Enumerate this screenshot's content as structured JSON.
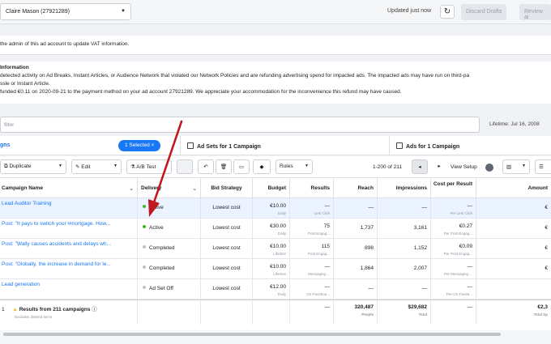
{
  "topbar": {
    "account": "Claire Mason (27921289)",
    "updated": "Updated just now",
    "discard": "Discard Drafts",
    "review": "Review ai"
  },
  "banner1": {
    "text": "the admin of this ad account to update VAT information."
  },
  "banner2": {
    "title": "Information",
    "line1": "detected activity on Ad Breaks, Instant Articles, or Audience Network that violated our Network Policies and are refunding advertising spend for impacted ads. The impacted ads may have run on third-pa",
    "line2": "ssle or Instant Article.",
    "line3": "funded €0.11 on 2020-09-21 to the payment method on your ad account 27921289. We appreciate your accommodation for the inconvenience this refund may have caused."
  },
  "filter": {
    "placeholder": "filter",
    "lifetime": "Lifetime: Jul 16, 2008"
  },
  "tabs": {
    "campaigns": "gns",
    "selected": "1 Selected",
    "adsets": "Ad Sets for 1 Campaign",
    "ads": "Ads for 1 Campaign"
  },
  "toolbar": {
    "duplicate": "Duplicate",
    "edit": "Edit",
    "abtest": "A/B Test",
    "rules": "Rules",
    "range": "1-200 of 211",
    "view_setup": "View Setup"
  },
  "headers": {
    "name": "Campaign Name",
    "delivery": "Delivery",
    "bid": "Bid Strategy",
    "budget": "Budget",
    "results": "Results",
    "reach": "Reach",
    "impressions": "Impressions",
    "cpr": "Cost per Result",
    "amount": "Amount"
  },
  "rows": [
    {
      "name": "Lead Auditor Training",
      "delivery": "Active",
      "status_color": "#42b72a",
      "bid": "Lowest cost",
      "budget": "€10.00",
      "budget_sub": "Daily",
      "results": "—",
      "results_sub": "Link Click",
      "reach": "—",
      "impressions": "—",
      "cpr": "—",
      "cpr_sub": "Per Link Click",
      "amount": "€"
    },
    {
      "name": "Post: \"It pays to switch your #mortgage. How...",
      "delivery": "Active",
      "status_color": "#42b72a",
      "bid": "Lowest cost",
      "budget": "€30.00",
      "budget_sub": "Daily",
      "results": "75",
      "results_sub": "Post Engag...",
      "reach": "1,737",
      "impressions": "3,161",
      "cpr": "€0.27",
      "cpr_sub": "Per Post Engag...",
      "amount": "€"
    },
    {
      "name": "Post: \"Wally causes accidents and delays wh...",
      "delivery": "Completed",
      "status_color": "#bec3c9",
      "bid": "Lowest cost",
      "budget": "€10.00",
      "budget_sub": "Lifetime",
      "results": "115",
      "results_sub": "Post Engag...",
      "reach": "898",
      "impressions": "1,152",
      "cpr": "€0.09",
      "cpr_sub": "Per Post Engag...",
      "amount": "€"
    },
    {
      "name": "Post: \"Globally, the increase in demand for le...",
      "delivery": "Completed",
      "status_color": "#bec3c9",
      "bid": "Lowest cost",
      "budget": "€10.00",
      "budget_sub": "Lifetime",
      "results": "—",
      "results_sub": "Messaging ...",
      "reach": "1,864",
      "impressions": "2,007",
      "cpr": "—",
      "cpr_sub": "Per Messaging ...",
      "amount": "€"
    },
    {
      "name": "Lead generation",
      "delivery": "Ad Set Off",
      "status_color": "#bec3c9",
      "bid": "Lowest cost",
      "budget": "€12.00",
      "budget_sub": "Daily",
      "results": "—",
      "results_sub": "On-Faceboo...",
      "reach": "—",
      "impressions": "—",
      "cpr": "—",
      "cpr_sub": "Per On-Faceb...",
      "amount": ""
    }
  ],
  "totals": {
    "label": "Results from 211 campaigns",
    "sub": "Excludes deleted items",
    "results": "—",
    "reach": "320,487",
    "reach_sub": "People",
    "impressions": "$29,682",
    "impressions_sub": "Total",
    "cpr": "—",
    "amount": "€2,3",
    "amount_sub": "Total Sp"
  }
}
